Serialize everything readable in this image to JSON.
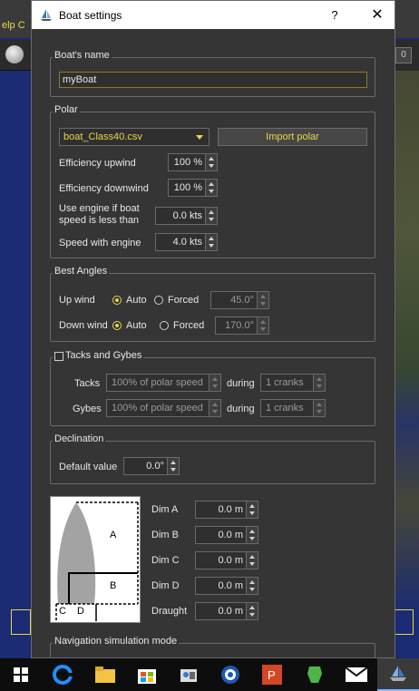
{
  "background": {
    "menu_text": "elp  C"
  },
  "dialog": {
    "title": "Boat settings",
    "help_label": "?",
    "close_label": "✕",
    "boat_name": {
      "title": "Boat's name",
      "value": "myBoat"
    },
    "polar": {
      "title": "Polar",
      "selected": "boat_Class40.csv",
      "import_label": "Import polar",
      "efficiency_upwind_label": "Efficiency upwind",
      "efficiency_upwind_value": "100 %",
      "efficiency_downwind_label": "Efficiency downwind",
      "efficiency_downwind_value": "100 %",
      "engine_threshold_label_1": "Use engine if boat",
      "engine_threshold_label_2": "speed is less than",
      "engine_threshold_value": "0.0 kts",
      "engine_speed_label": "Speed with engine",
      "engine_speed_value": "4.0 kts"
    },
    "best_angles": {
      "title": "Best Angles",
      "upwind_label": "Up wind",
      "downwind_label": "Down wind",
      "auto_label": "Auto",
      "forced_label": "Forced",
      "upwind_value": "45.0°",
      "downwind_value": "170.0°"
    },
    "tacks_gybes": {
      "title": "Tacks and Gybes",
      "tacks_label": "Tacks",
      "gybes_label": "Gybes",
      "during_label": "during",
      "tacks_speed": "100% of polar speed",
      "gybes_speed": "100% of polar speed",
      "tacks_cranks": "1 cranks",
      "gybes_cranks": "1 cranks"
    },
    "declination": {
      "title": "Declination",
      "default_label": "Default value",
      "default_value": "0.0°"
    },
    "dimensions": {
      "diagram_labels": {
        "a": "A",
        "b": "B",
        "c": "C",
        "d": "D"
      },
      "dim_a_label": "Dim A",
      "dim_a_value": "0.0 m",
      "dim_b_label": "Dim B",
      "dim_b_value": "0.0 m",
      "dim_c_label": "Dim C",
      "dim_c_value": "0.0 m",
      "dim_d_label": "Dim D",
      "dim_d_value": "0.0 m",
      "draught_label": "Draught",
      "draught_value": "0.0 m"
    },
    "nav_sim": {
      "title": "Navigation simulation mode"
    }
  },
  "taskbar": {
    "items": [
      "windows-icon",
      "edge-icon",
      "file-explorer-icon",
      "store-icon",
      "photos-icon",
      "app-icon",
      "powerpoint-icon",
      "evernote-icon",
      "mail-icon",
      "qtvlm-icon"
    ]
  },
  "colors": {
    "accent": "#e8d84a",
    "dialog_bg": "#353535",
    "map_bg": "#1b2b74"
  }
}
